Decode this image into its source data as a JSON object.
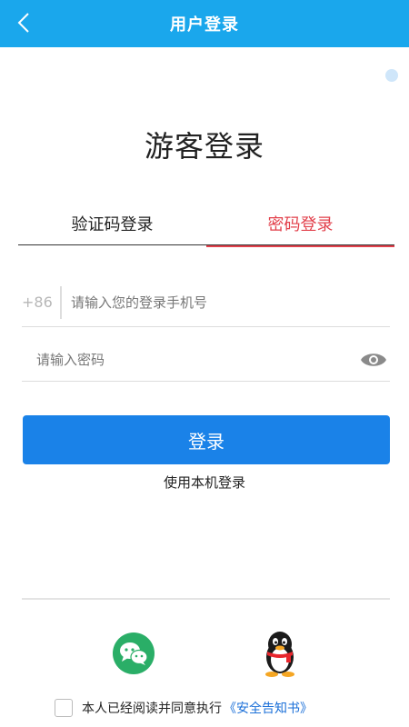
{
  "header": {
    "title": "用户登录",
    "back_icon": "chevron-left-icon",
    "bg_color": "#1aa7ec"
  },
  "page_title": "游客登录",
  "tabs": [
    {
      "label": "验证码登录",
      "active": false
    },
    {
      "label": "密码登录",
      "active": true,
      "active_color": "#e2404b"
    }
  ],
  "phone": {
    "country_code": "+86",
    "placeholder": "请输入您的登录手机号",
    "value": ""
  },
  "password": {
    "placeholder": "请输入密码",
    "value": "",
    "toggle_icon": "eye-icon"
  },
  "login_button": {
    "label": "登录",
    "color": "#1a82e8"
  },
  "local_login_label": "使用本机登录",
  "social": [
    {
      "name": "wechat",
      "icon": "wechat-icon",
      "color": "#2aae67"
    },
    {
      "name": "qq",
      "icon": "qq-penguin-icon"
    }
  ],
  "agreement": {
    "text": "本人已经阅读并同意执行",
    "link": "《安全告知书》",
    "checked": false
  }
}
